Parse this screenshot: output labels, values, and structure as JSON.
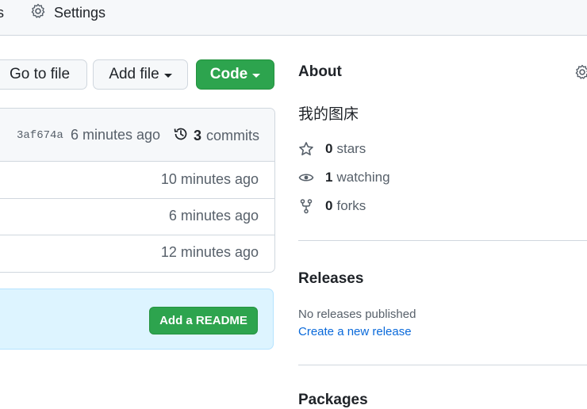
{
  "nav": {
    "partial_tab": "s",
    "settings_label": "Settings"
  },
  "actions": {
    "go_to_file": "Go to file",
    "add_file": "Add file",
    "code": "Code"
  },
  "commit": {
    "sha": "3af674a",
    "time": "6 minutes ago",
    "count": "3",
    "count_label": "commits"
  },
  "files": [
    {
      "time": "10 minutes ago"
    },
    {
      "time": "6 minutes ago"
    },
    {
      "time": "12 minutes ago"
    }
  ],
  "readme_banner": {
    "button": "Add a README"
  },
  "about": {
    "title": "About",
    "description": "我的图床",
    "stars_count": "0",
    "stars_label": "stars",
    "watching_count": "1",
    "watching_label": "watching",
    "forks_count": "0",
    "forks_label": "forks"
  },
  "releases": {
    "title": "Releases",
    "empty": "No releases published",
    "create_link": "Create a new release"
  },
  "packages": {
    "title": "Packages"
  },
  "colors": {
    "primary_green": "#2da44e",
    "link_blue": "#0969da",
    "banner_blue": "#ddf4ff",
    "border": "#d0d7de"
  }
}
